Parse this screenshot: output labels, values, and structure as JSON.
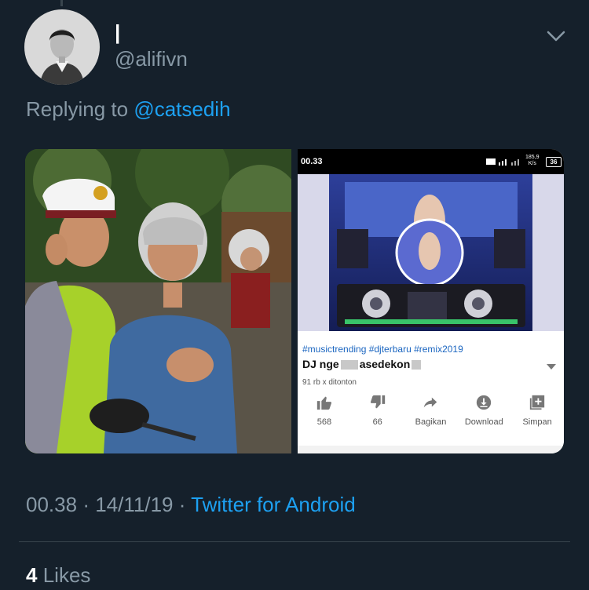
{
  "tweet": {
    "display_name": "|",
    "handle": "@alifivn",
    "reply_prefix": "Replying to",
    "reply_to": "@catsedih",
    "time": "00.38",
    "date": "14/11/19",
    "separator": "·",
    "source": "Twitter for Android",
    "likes_count": "4",
    "likes_label": "Likes"
  },
  "screenshot": {
    "status_time": "00.33",
    "speed_value": "185,9",
    "speed_unit": "K/s",
    "battery": "36",
    "hashtags": "#musictrending #djterbaru #remix2019",
    "title_part1": "DJ nge",
    "title_part2": "asedekon",
    "views": "91 rb x ditonton",
    "actions": [
      {
        "icon": "thumbs-up-icon",
        "label": "568"
      },
      {
        "icon": "thumbs-down-icon",
        "label": "66"
      },
      {
        "icon": "share-icon",
        "label": "Bagikan"
      },
      {
        "icon": "download-icon",
        "label": "Download"
      },
      {
        "icon": "save-playlist-icon",
        "label": "Simpan"
      }
    ]
  },
  "colors": {
    "background": "#15202b",
    "secondary_text": "#8899a6",
    "link": "#1da1f2",
    "divider": "#38444d"
  }
}
